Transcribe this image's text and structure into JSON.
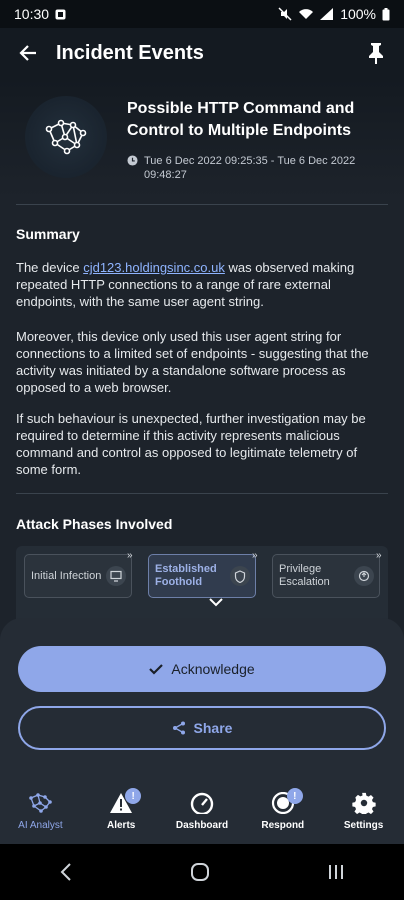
{
  "status": {
    "time": "10:30",
    "battery": "100%"
  },
  "app_bar": {
    "title": "Incident Events"
  },
  "incident": {
    "title": "Possible HTTP Command and Control to Multiple Endpoints",
    "time_range": "Tue 6 Dec 2022 09:25:35 - Tue 6 Dec 2022 09:48:27"
  },
  "summary": {
    "heading": "Summary",
    "p1_prefix": "The device ",
    "device_link": "cjd123.holdingsinc.co.uk",
    "p1_suffix": " was observed making repeated HTTP connections to a range of rare external endpoints, with the same user agent string.",
    "p2": "Moreover, this device only used this user agent string for connections to a limited set of endpoints - suggesting that the activity was initiated by a standalone software process as opposed to a web browser.",
    "p3": "If such behaviour is unexpected, further investigation may be required to determine if this activity represents malicious command and control as opposed to legitimate telemetry of some form."
  },
  "phases": {
    "heading": "Attack Phases Involved",
    "items": [
      {
        "label": "Initial Infection",
        "icon": "monitor-icon",
        "active": false
      },
      {
        "label": "Established Foothold",
        "icon": "shield-icon",
        "active": true
      },
      {
        "label": "Privilege Escalation",
        "icon": "privilege-icon",
        "active": false
      }
    ]
  },
  "actions": {
    "acknowledge": "Acknowledge",
    "share": "Share"
  },
  "nav": {
    "items": [
      {
        "label": "AI Analyst",
        "icon": "ai-analyst-icon",
        "active": true
      },
      {
        "label": "Alerts",
        "icon": "alert-icon",
        "badge": "!"
      },
      {
        "label": "Dashboard",
        "icon": "dashboard-icon"
      },
      {
        "label": "Respond",
        "icon": "respond-icon",
        "badge": "!"
      },
      {
        "label": "Settings",
        "icon": "gear-icon"
      }
    ]
  },
  "colors": {
    "accent": "#8fa7e9",
    "background": "#1d232b",
    "sheet": "#252c35"
  }
}
